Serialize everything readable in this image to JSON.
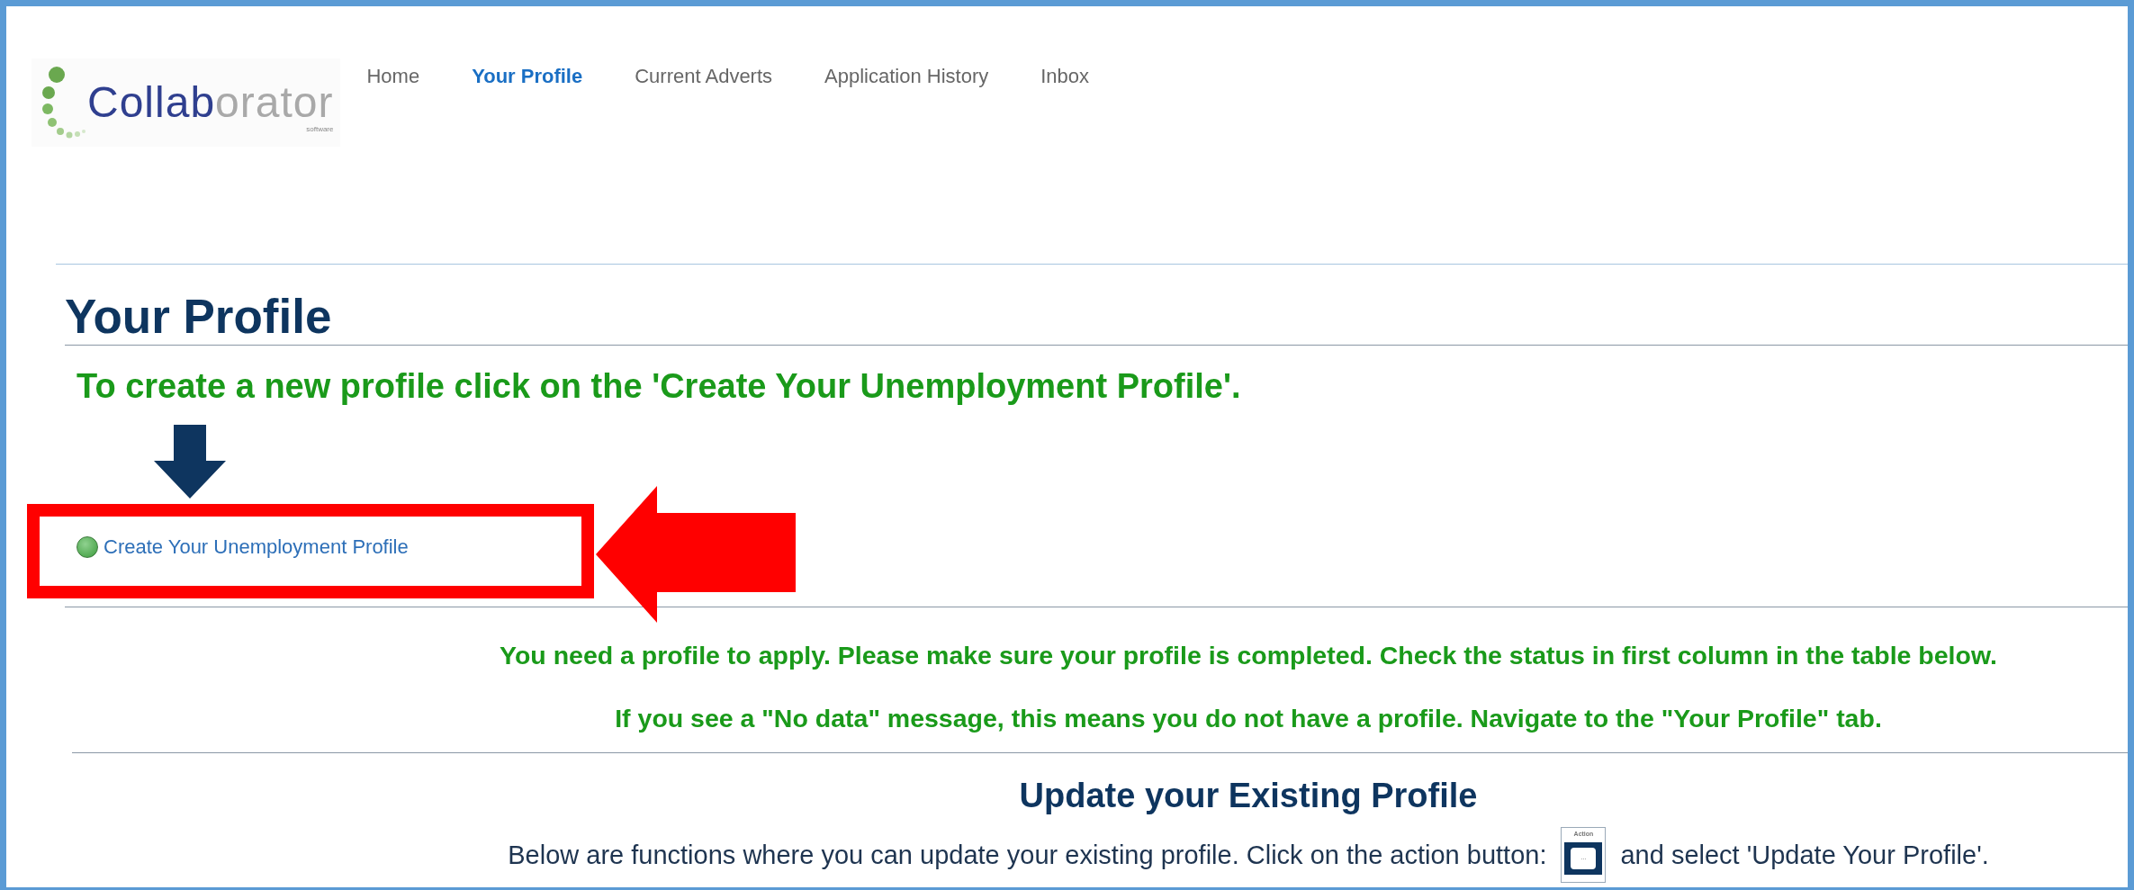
{
  "logo": {
    "text_main": "Collab",
    "text_light": "orator",
    "tagline": "software"
  },
  "nav": [
    {
      "label": "Home",
      "selected": false
    },
    {
      "label": "Your Profile",
      "selected": true
    },
    {
      "label": "Current Adverts",
      "selected": false
    },
    {
      "label": "Application History",
      "selected": false
    },
    {
      "label": "Inbox",
      "selected": false
    }
  ],
  "page_title": "Your Profile",
  "instruction": "To create a new profile click on the 'Create Your Unemployment Profile'.",
  "create_link": {
    "label": "Create Your Unemployment Profile"
  },
  "notices": [
    "You need a profile to apply. Please make sure your profile is completed. Check the status in first column in the table below.",
    "If you see a \"No data\" message, this means you do not have a profile. Navigate to the \"Your Profile\" tab."
  ],
  "section": {
    "title": "Update your Existing Profile",
    "text_before": "Below are functions where you can update your existing profile. Click on the action button:",
    "action_icon": {
      "label": "Action",
      "dots": "..."
    },
    "text_after": "and select 'Update Your Profile'."
  }
}
